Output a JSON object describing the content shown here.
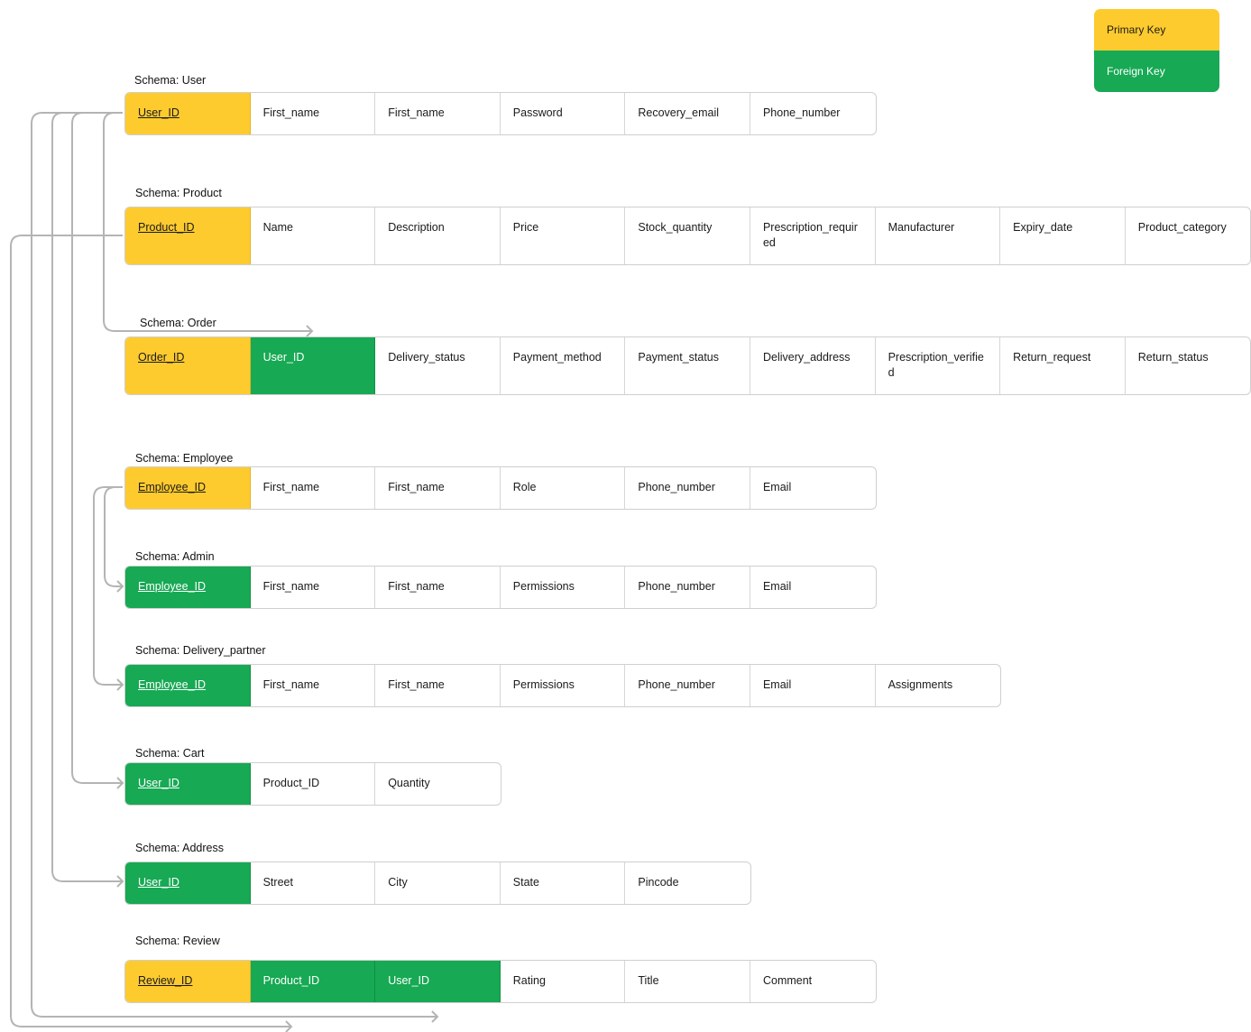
{
  "legend": {
    "primary_key": "Primary Key",
    "foreign_key": "Foreign Key"
  },
  "colors": {
    "primary_key": "#FECB2F",
    "foreign_key": "#17A954",
    "connector": "#b4b4b4"
  },
  "schemas": [
    {
      "id": "user",
      "label": "Schema: User",
      "columns": [
        {
          "name": "User_ID",
          "kind": "pk",
          "underline": true
        },
        {
          "name": "First_name"
        },
        {
          "name": "First_name"
        },
        {
          "name": "Password"
        },
        {
          "name": "Recovery_email"
        },
        {
          "name": "Phone_number"
        }
      ]
    },
    {
      "id": "product",
      "label": "Schema: Product",
      "columns": [
        {
          "name": "Product_ID",
          "kind": "pk",
          "underline": true
        },
        {
          "name": "Name"
        },
        {
          "name": "Description"
        },
        {
          "name": "Price"
        },
        {
          "name": "Stock_quantity"
        },
        {
          "name": "Prescription_required"
        },
        {
          "name": "Manufacturer"
        },
        {
          "name": "Expiry_date"
        },
        {
          "name": "Product_category"
        }
      ]
    },
    {
      "id": "order",
      "label": "Schema: Order",
      "columns": [
        {
          "name": "Order_ID",
          "kind": "pk",
          "underline": true
        },
        {
          "name": "User_ID",
          "kind": "fk"
        },
        {
          "name": "Delivery_status"
        },
        {
          "name": "Payment_method"
        },
        {
          "name": "Payment_status"
        },
        {
          "name": "Delivery_address"
        },
        {
          "name": "Prescription_verified"
        },
        {
          "name": "Return_request"
        },
        {
          "name": "Return_status"
        }
      ]
    },
    {
      "id": "employee",
      "label": "Schema: Employee",
      "columns": [
        {
          "name": "Employee_ID",
          "kind": "pk",
          "underline": true
        },
        {
          "name": "First_name"
        },
        {
          "name": "First_name"
        },
        {
          "name": "Role"
        },
        {
          "name": "Phone_number"
        },
        {
          "name": "Email"
        }
      ]
    },
    {
      "id": "admin",
      "label": "Schema: Admin",
      "columns": [
        {
          "name": "Employee_ID",
          "kind": "fk",
          "underline": true
        },
        {
          "name": "First_name"
        },
        {
          "name": "First_name"
        },
        {
          "name": "Permissions"
        },
        {
          "name": "Phone_number"
        },
        {
          "name": "Email"
        }
      ]
    },
    {
      "id": "delivery_partner",
      "label": "Schema: Delivery_partner",
      "columns": [
        {
          "name": "Employee_ID",
          "kind": "fk",
          "underline": true
        },
        {
          "name": "First_name"
        },
        {
          "name": "First_name"
        },
        {
          "name": "Permissions"
        },
        {
          "name": "Phone_number"
        },
        {
          "name": "Email"
        },
        {
          "name": "Assignments"
        }
      ]
    },
    {
      "id": "cart",
      "label": "Schema: Cart",
      "columns": [
        {
          "name": "User_ID",
          "kind": "fk",
          "underline": true
        },
        {
          "name": "Product_ID"
        },
        {
          "name": "Quantity"
        }
      ]
    },
    {
      "id": "address",
      "label": "Schema: Address",
      "columns": [
        {
          "name": "User_ID",
          "kind": "fk",
          "underline": true
        },
        {
          "name": "Street"
        },
        {
          "name": "City"
        },
        {
          "name": "State"
        },
        {
          "name": "Pincode"
        }
      ]
    },
    {
      "id": "review",
      "label": "Schema: Review",
      "columns": [
        {
          "name": "Review_ID",
          "kind": "pk",
          "underline": true
        },
        {
          "name": "Product_ID",
          "kind": "fk"
        },
        {
          "name": "User_ID",
          "kind": "fk"
        },
        {
          "name": "Rating"
        },
        {
          "name": "Title"
        },
        {
          "name": "Comment"
        }
      ]
    }
  ],
  "relationships": [
    {
      "from": "user.User_ID",
      "to": "order.User_ID"
    },
    {
      "from": "user.User_ID",
      "to": "cart.User_ID"
    },
    {
      "from": "user.User_ID",
      "to": "address.User_ID"
    },
    {
      "from": "user.User_ID",
      "to": "review.User_ID"
    },
    {
      "from": "product.Product_ID",
      "to": "review.Product_ID"
    },
    {
      "from": "employee.Employee_ID",
      "to": "admin.Employee_ID"
    },
    {
      "from": "employee.Employee_ID",
      "to": "delivery_partner.Employee_ID"
    }
  ]
}
